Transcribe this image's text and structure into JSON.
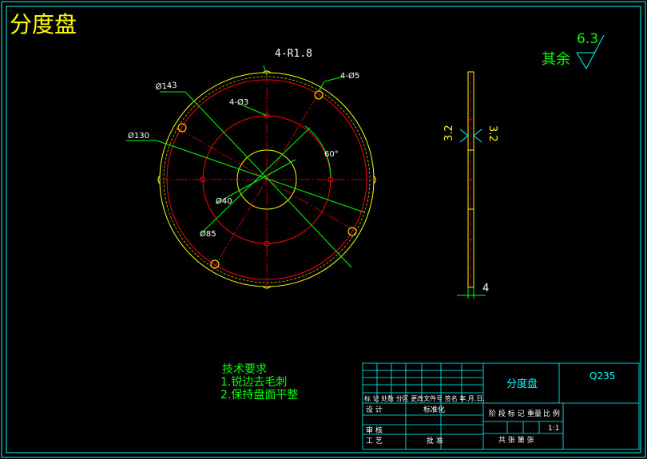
{
  "drawing": {
    "title_corner": "分度盘",
    "colors": {
      "background": "#000000",
      "frame": "#00ffff",
      "outline": "#ffff00",
      "circles": "#ff0000",
      "dimension": "#00ff00",
      "text_white": "#ffffff",
      "title_yellow": "#ffff00"
    }
  },
  "front_view": {
    "dim_holes_r": "4-R1.8",
    "dim_d143": "Ø143",
    "dim_d130": "Ø130",
    "dim_d5": "4-Ø5",
    "dim_d3": "4-Ø3",
    "dim_angle": "60°",
    "dim_d40": "Ø40",
    "dim_d85": "Ø85"
  },
  "side_view": {
    "rough_left": "3.2",
    "rough_right": "3.2",
    "thickness": "4"
  },
  "roughness_note": {
    "value": "6.3",
    "label": "其余"
  },
  "tech_requirements": {
    "title": "技术要求",
    "items": [
      "1.锐边去毛刺",
      "2.保持盘面平整"
    ]
  },
  "title_block": {
    "part_name": "分度盘",
    "material": "Q235",
    "row_marks": "标 记 处数 分区 更改文件号 签名 年.月.日.",
    "design": "设 计",
    "standardize": "标准化",
    "stage": "阶 段 标 记",
    "weight": "重量",
    "scale_label": "比 例",
    "scale_value": "1:1",
    "review": "审 核",
    "process": "工 艺",
    "approve": "批 准",
    "sheets": "共   张 第   张"
  }
}
